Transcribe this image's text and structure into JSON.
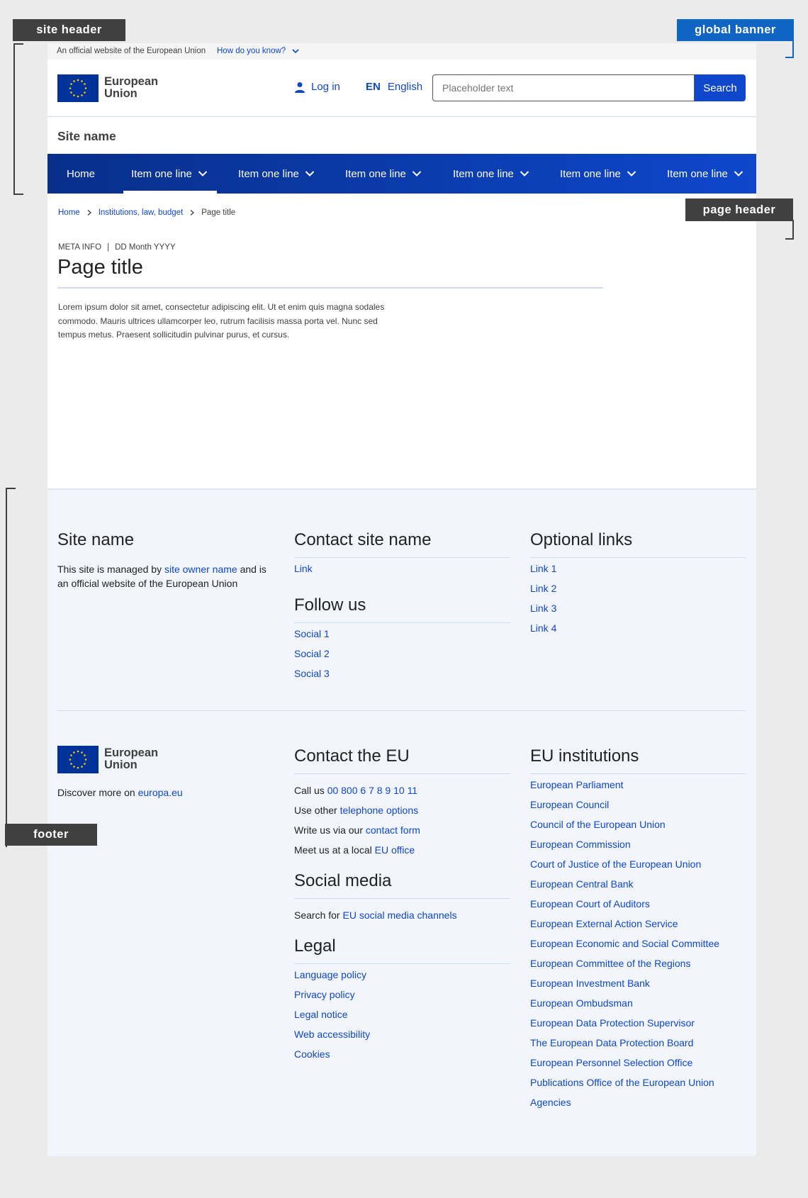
{
  "annotations": {
    "site_header": "site header",
    "global_banner": "global banner",
    "page_header": "page header",
    "footer": "footer"
  },
  "global_banner": {
    "text": "An official website of the European Union",
    "link": "How do you know?"
  },
  "header": {
    "logo_line1": "European",
    "logo_line2": "Union",
    "login": "Log in",
    "lang_code": "EN",
    "lang_name": "English",
    "search_placeholder": "Placeholder text",
    "search_button": "Search",
    "site_name": "Site name"
  },
  "menu": {
    "home": "Home",
    "items": [
      "Item one line",
      "Item one line",
      "Item one line",
      "Item one line",
      "Item one line",
      "Item one line"
    ]
  },
  "page_header": {
    "breadcrumbs": [
      "Home",
      "Institutions, law, budget",
      "Page title"
    ],
    "meta": "META INFO",
    "date": "DD Month YYYY",
    "title": "Page title",
    "intro": "Lorem ipsum dolor sit amet, consectetur adipiscing elit. Ut et enim quis magna sodales commodo. Mauris ultrices ullamcorper leo, rutrum facilisis massa porta vel. Nunc sed tempus metus. Praesent sollicitudin pulvinar purus, et cursus."
  },
  "footer_top": {
    "site_name": "Site name",
    "managed_pre": "This site is managed by",
    "managed_link": "site owner name",
    "managed_post": "and is",
    "managed_line2": "an official website of the European Union",
    "contact_heading": "Contact site name",
    "contact_link": "Link",
    "follow_heading": "Follow us",
    "social": [
      "Social 1",
      "Social 2",
      "Social 3"
    ],
    "optional_heading": "Optional links",
    "optional": [
      "Link 1",
      "Link 2",
      "Link 3",
      "Link 4"
    ]
  },
  "footer_bottom": {
    "logo_line1": "European",
    "logo_line2": "Union",
    "discover_pre": "Discover more on",
    "discover_link": "europa.eu",
    "contact_heading": "Contact the EU",
    "contact_rows": [
      {
        "pre": "Call us",
        "link": "00 800 6 7 8 9 10 11"
      },
      {
        "pre": "Use other",
        "link": "telephone options"
      },
      {
        "pre": "Write us via our",
        "link": "contact form"
      },
      {
        "pre": "Meet us at a local",
        "link": "EU office"
      }
    ],
    "social_heading": "Social media",
    "social_pre": "Search for",
    "social_link": "EU social media channels",
    "legal_heading": "Legal",
    "legal": [
      "Language policy",
      "Privacy policy",
      "Legal notice",
      "Web accessibility",
      "Cookies"
    ],
    "institutions_heading": "EU institutions",
    "institutions": [
      "European Parliament",
      "European Council",
      "Council of the European Union",
      "European Commission",
      "Court of Justice of the European Union",
      "European Central Bank",
      "European Court of Auditors",
      "European External Action Service",
      "European Economic and Social Committee",
      "European Committee of the Regions",
      "European Investment Bank",
      "European Ombudsman",
      "European Data Protection Supervisor",
      "The European Data Protection Board",
      "European Personnel Selection Office",
      "Publications Office of the European Union",
      "Agencies"
    ]
  },
  "colors": {
    "link": "#0e47cb",
    "menu_dark": "#082f8a",
    "eu_blue": "#003399",
    "eu_gold": "#ffcc00",
    "footer_bg": "#f2f5fb",
    "annotation_dark": "#404040",
    "annotation_blue": "#0e65c4"
  }
}
